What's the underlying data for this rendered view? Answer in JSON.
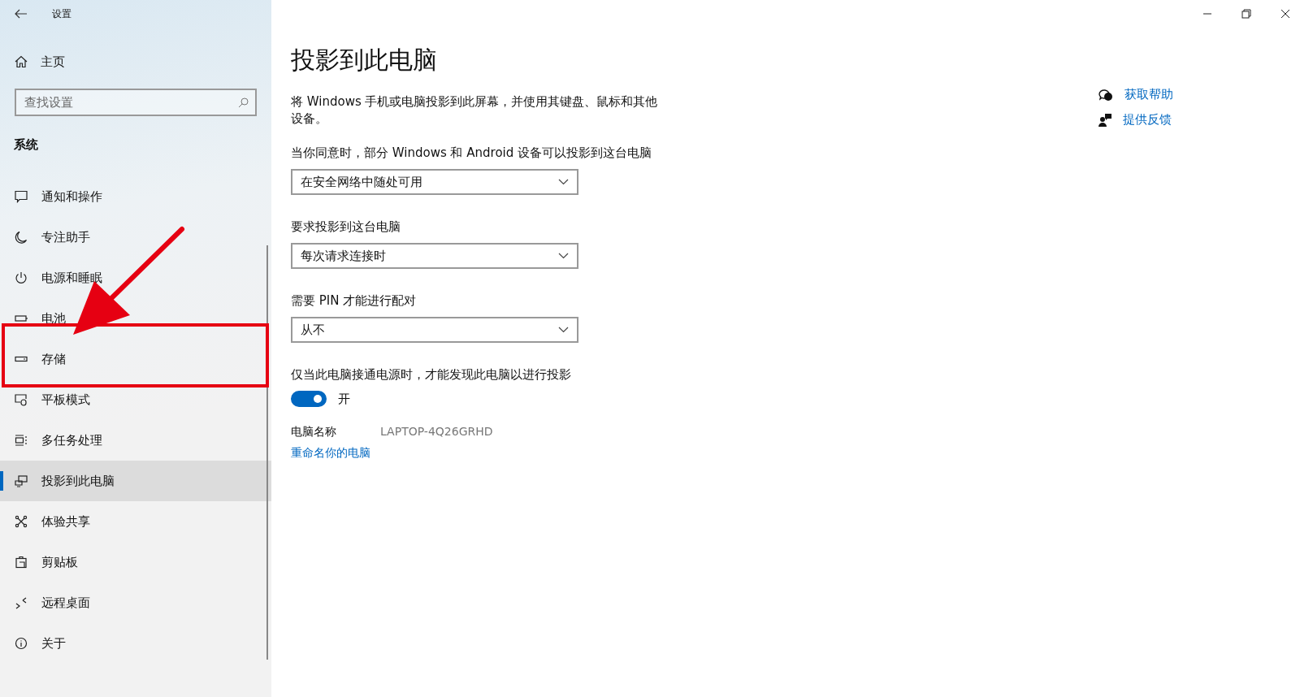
{
  "window": {
    "title": "设置"
  },
  "sidebar": {
    "home": "主页",
    "search": {
      "placeholder": "查找设置"
    },
    "section": "系统",
    "items": [
      {
        "kind": "notify",
        "label": "通知和操作",
        "selected": false
      },
      {
        "kind": "moon",
        "label": "专注助手",
        "selected": false
      },
      {
        "kind": "power",
        "label": "电源和睡眠",
        "selected": false
      },
      {
        "kind": "battery",
        "label": "电池",
        "selected": false
      },
      {
        "kind": "storage",
        "label": "存储",
        "selected": false
      },
      {
        "kind": "tablet",
        "label": "平板模式",
        "selected": false
      },
      {
        "kind": "multitask",
        "label": "多任务处理",
        "selected": false
      },
      {
        "kind": "project",
        "label": "投影到此电脑",
        "selected": true
      },
      {
        "kind": "share",
        "label": "体验共享",
        "selected": false
      },
      {
        "kind": "clipboard",
        "label": "剪贴板",
        "selected": false
      },
      {
        "kind": "remote",
        "label": "远程桌面",
        "selected": false
      },
      {
        "kind": "about",
        "label": "关于",
        "selected": false
      }
    ]
  },
  "page": {
    "title": "投影到此电脑",
    "description": "将 Windows 手机或电脑投影到此屏幕，并使用其键盘、鼠标和其他设备。",
    "settings": [
      {
        "label": "当你同意时，部分 Windows 和 Android 设备可以投影到这台电脑",
        "value": "在安全网络中随处可用"
      },
      {
        "label": "要求投影到这台电脑",
        "value": "每次请求连接时"
      },
      {
        "label": "需要 PIN 才能进行配对",
        "value": "从不"
      }
    ],
    "power_toggle": {
      "label": "仅当此电脑接通电源时，才能发现此电脑以进行投影",
      "on": true,
      "state_text": "开"
    },
    "pc_name": {
      "label": "电脑名称",
      "value": "LAPTOP-4Q26GRHD"
    },
    "rename_link": "重命名你的电脑"
  },
  "help_links": [
    {
      "kind": "help",
      "label": "获取帮助"
    },
    {
      "kind": "feedback",
      "label": "提供反馈"
    }
  ]
}
